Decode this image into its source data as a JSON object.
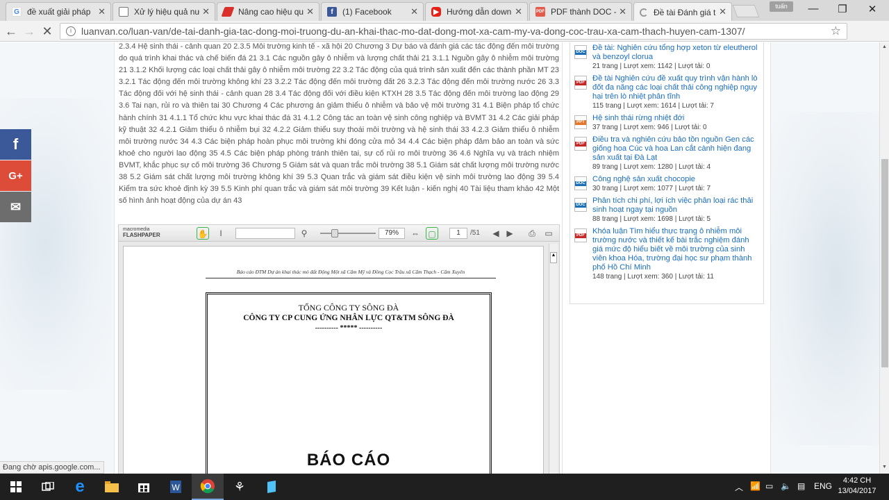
{
  "browser": {
    "tabs": [
      {
        "label": "đề xuất giải pháp",
        "favicon": "google-icon",
        "active": false
      },
      {
        "label": "Xử lý hiệu quả nư",
        "favicon": "page-icon",
        "active": false
      },
      {
        "label": "Nâng cao hiệu quả",
        "favicon": "site-icon",
        "active": false
      },
      {
        "label": "(1) Facebook",
        "favicon": "facebook-icon",
        "active": false
      },
      {
        "label": "Hướng dẫn downl",
        "favicon": "youtube-icon",
        "active": false
      },
      {
        "label": "PDF thành DOC -",
        "favicon": "pdf-icon",
        "active": false
      },
      {
        "label": "Đề tài Đánh giá tá",
        "favicon": "loading-icon",
        "active": true
      }
    ],
    "user_badge": "tuấn",
    "url": "luanvan.co/luan-van/de-tai-danh-gia-tac-dong-moi-truong-du-an-khai-thac-mo-dat-dong-mot-xa-cam-my-va-dong-coc-trau-xa-cam-thach-huyen-cam-1307/",
    "status_text": "Đang chờ apis.google.com..."
  },
  "article": {
    "toc_text": "2.3.4 Hệ sinh thái - cảnh quan 20 2.3.5 Môi trường kinh tế - xã hội 20 Chương 3 Dự báo và đánh giá các tác động đến môi trường do quá trình khai thác và chế biến đá 21 3.1 Các nguồn gây ô nhiễm và lượng chất thải 21 3.1.1 Nguồn gây ô nhiễm môi trường 21 3.1.2 Khối lượng các loại chất thải gây ô nhiễm môi trường 22 3.2 Tác động của quá trình sản xuất đến các thành phần MT 23 3.2.1 Tác động đến môi trường không khí 23 3.2.2 Tác động đến môi trường đất 26 3.2.3 Tác động đến môi trường nước 26 3.3 Tác động đối với hệ sinh thái - cảnh quan 28 3.4 Tác động đối với điều kiện KTXH 28 3.5 Tác động đến môi trường lao động 29 3.6 Tai nạn, rủi ro và thiên tai 30 Chương 4 Các phương án giảm thiểu ô nhiễm và bảo vệ môi trường 31 4.1 Biện pháp tổ chức hành chính 31 4.1.1 Tổ chức khu vực khai thác đá 31 4.1.2 Công tác an toàn vệ sinh công nghiệp và BVMT 31 4.2 Các giải pháp kỹ thuật 32 4.2.1 Giảm thiểu ô nhiễm bụi 32 4.2.2 Giảm thiểu suy thoái môi trường và hệ sinh thái 33 4.2.3 Giảm thiểu ô nhiễm môi trường nước 34 4.3 Các biện pháp hoàn phục môi trường khi đóng cửa mỏ 34 4.4 Các biện pháp đảm bảo an toàn và sức khoẻ cho người lao động 35 4.5 Các biện pháp phòng tránh thiên tai, sự cố rủi ro môi trường 36 4.6 Nghĩa vụ và trách nhiệm BVMT, khắc phục sự cố môi trường 36 Chương 5 Giám sát và quan trắc môi trường 38 5.1 Giám sát chất lượng môi trường nước 38 5.2 Giám sát chất lượng môi trường không khí 39 5.3 Quan trắc và giám sát điều kiện vệ sinh môi trường lao động 39 5.4 Kiểm tra sức khoẻ định kỳ 39 5.5 Kinh phí quan trắc và giám sát môi trường 39 Kết luận - kiến nghị 40 Tài liệu tham khảo 42 Một số hình ảnh hoạt động của dự án 43"
  },
  "viewer": {
    "logo_top": "macromedia",
    "logo_bottom": "FLASHPAPER",
    "zoom": "79%",
    "page": "1",
    "page_total": "/51",
    "doc_header": "Báo cáo ĐTM  Dự án khai thác mỏ đất Động Một xã Cẩm Mỹ và Đồng Cọc Trầu  xã Cẩm Thạch - Cẩm Xuyên",
    "doc_line1": "TỔNG CÔNG TY SÔNG ĐÀ",
    "doc_line2": "CÔNG TY CP CUNG ỨNG NHÂN LỰC QT&TM SÔNG ĐÀ",
    "doc_line3": "---------- ***** ----------",
    "doc_big": "BÁO CÁO"
  },
  "related": [
    {
      "type": "DOC",
      "title": "Đề tài: Nghiên cứu tổng hợp xeton từ eleutherol và benzoyl clorua",
      "meta": "21 trang | Lượt xem: 1142 | Lượt tải: 0"
    },
    {
      "type": "PDF",
      "title": "Đề tài Nghiên cứu đề xuất quy trình vận hành lò đốt đa năng các loại chất thải công nghiệp nguy hại trên lò nhiệt phân tĩnh",
      "meta": "115 trang | Lượt xem: 1614 | Lượt tải: 7"
    },
    {
      "type": "PPT",
      "title": "Hệ sinh thái rừng nhiệt đới",
      "meta": "37 trang | Lượt xem: 946 | Lượt tải: 0"
    },
    {
      "type": "PDF",
      "title": "Điều tra và nghiên cứu bảo tồn nguồn Gen các giống hoa Cúc và hoa Lan cắt cành hiện đang sản xuất tại Đà Lạt",
      "meta": "89 trang | Lượt xem: 1280 | Lượt tải: 4"
    },
    {
      "type": "DOC",
      "title": "Công nghệ sản xuất chocopie",
      "meta": "30 trang | Lượt xem: 1077 | Lượt tải: 7"
    },
    {
      "type": "DOC",
      "title": "Phân tích chi phí, lợi ích việc phân loại rác thải sinh hoạt ngay tại nguồn",
      "meta": "88 trang | Lượt xem: 1698 | Lượt tải: 5"
    },
    {
      "type": "PDF",
      "title": "Khóa luận Tìm hiểu thực trạng ô nhiễm môi trường nước và thiết kế bài trắc nghiệm đánh giá mức độ hiểu biết về môi trường của sinh viên khoa Hóa, trường đại học sư phạm thành phố Hồ Chí Minh",
      "meta": "148 trang | Lượt xem: 360 | Lượt tải: 11"
    }
  ],
  "social": [
    {
      "label": "f",
      "color": "#3b5998"
    },
    {
      "label": "G+",
      "color": "#dd4b39"
    },
    {
      "label": "✉",
      "color": "#6d6d6d"
    }
  ],
  "taskbar": {
    "language": "ENG",
    "time": "4:42 CH",
    "date": "13/04/2017"
  }
}
